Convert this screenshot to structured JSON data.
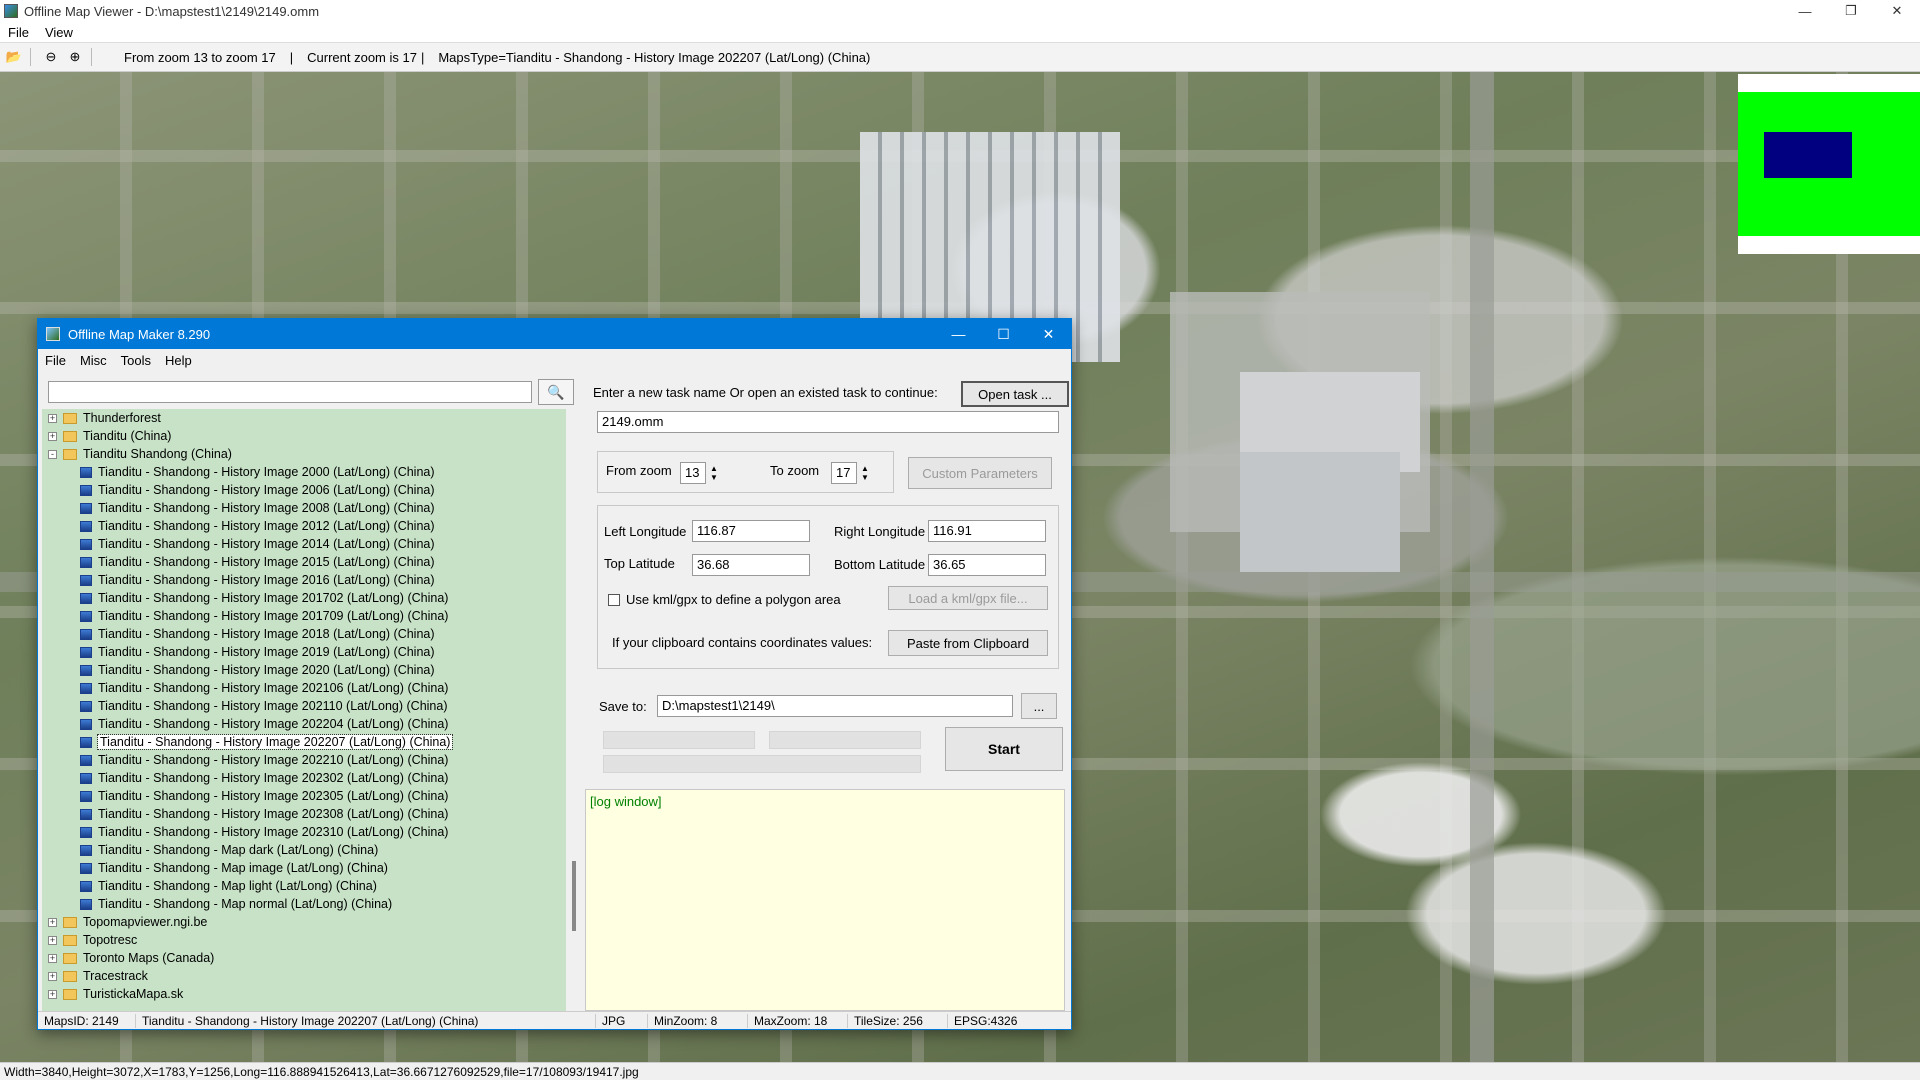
{
  "viewer": {
    "title": "Offline Map Viewer - D:\\mapstest1\\2149\\2149.omm",
    "menu": [
      "File",
      "View"
    ],
    "toolbar": {
      "zoom_range": "From zoom 13 to zoom 17",
      "current_zoom": "Current zoom is 17",
      "maps_type": "MapsType=Tianditu - Shandong - History Image 202207 (Lat/Long) (China)"
    },
    "status": "Width=3840,Height=3072,X=1783,Y=1256,Long=116.888941526413,Lat=36.6671276092529,file=17/108093/19417.jpg"
  },
  "maker": {
    "title": "Offline Map Maker 8.290",
    "menu": [
      "File",
      "Misc",
      "Tools",
      "Help"
    ],
    "search_value": "",
    "tree": [
      {
        "level": 0,
        "type": "folder",
        "expand": "+",
        "label": "Thunderforest"
      },
      {
        "level": 0,
        "type": "folder",
        "expand": "+",
        "label": "Tianditu (China)"
      },
      {
        "level": 0,
        "type": "folder",
        "expand": "-",
        "label": "Tianditu Shandong (China)"
      },
      {
        "level": 1,
        "type": "map",
        "label": "Tianditu - Shandong - History Image 2000 (Lat/Long) (China)"
      },
      {
        "level": 1,
        "type": "map",
        "label": "Tianditu - Shandong - History Image 2006 (Lat/Long) (China)"
      },
      {
        "level": 1,
        "type": "map",
        "label": "Tianditu - Shandong - History Image 2008 (Lat/Long) (China)"
      },
      {
        "level": 1,
        "type": "map",
        "label": "Tianditu - Shandong - History Image 2012 (Lat/Long) (China)"
      },
      {
        "level": 1,
        "type": "map",
        "label": "Tianditu - Shandong - History Image 2014 (Lat/Long) (China)"
      },
      {
        "level": 1,
        "type": "map",
        "label": "Tianditu - Shandong - History Image 2015 (Lat/Long) (China)"
      },
      {
        "level": 1,
        "type": "map",
        "label": "Tianditu - Shandong - History Image 2016 (Lat/Long) (China)"
      },
      {
        "level": 1,
        "type": "map",
        "label": "Tianditu - Shandong - History Image 201702 (Lat/Long) (China)"
      },
      {
        "level": 1,
        "type": "map",
        "label": "Tianditu - Shandong - History Image 201709 (Lat/Long) (China)"
      },
      {
        "level": 1,
        "type": "map",
        "label": "Tianditu - Shandong - History Image 2018 (Lat/Long) (China)"
      },
      {
        "level": 1,
        "type": "map",
        "label": "Tianditu - Shandong - History Image 2019 (Lat/Long) (China)"
      },
      {
        "level": 1,
        "type": "map",
        "label": "Tianditu - Shandong - History Image 2020 (Lat/Long) (China)"
      },
      {
        "level": 1,
        "type": "map",
        "label": "Tianditu - Shandong - History Image 202106 (Lat/Long) (China)"
      },
      {
        "level": 1,
        "type": "map",
        "label": "Tianditu - Shandong - History Image 202110 (Lat/Long) (China)"
      },
      {
        "level": 1,
        "type": "map",
        "label": "Tianditu - Shandong - History Image 202204 (Lat/Long) (China)"
      },
      {
        "level": 1,
        "type": "map",
        "label": "Tianditu - Shandong - History Image 202207 (Lat/Long) (China)",
        "selected": true
      },
      {
        "level": 1,
        "type": "map",
        "label": "Tianditu - Shandong - History Image 202210 (Lat/Long) (China)"
      },
      {
        "level": 1,
        "type": "map",
        "label": "Tianditu - Shandong - History Image 202302 (Lat/Long) (China)"
      },
      {
        "level": 1,
        "type": "map",
        "label": "Tianditu - Shandong - History Image 202305 (Lat/Long) (China)"
      },
      {
        "level": 1,
        "type": "map",
        "label": "Tianditu - Shandong - History Image 202308 (Lat/Long) (China)"
      },
      {
        "level": 1,
        "type": "map",
        "label": "Tianditu - Shandong - History Image 202310 (Lat/Long) (China)"
      },
      {
        "level": 1,
        "type": "map",
        "label": "Tianditu - Shandong - Map dark (Lat/Long) (China)"
      },
      {
        "level": 1,
        "type": "map",
        "label": "Tianditu - Shandong - Map image (Lat/Long) (China)"
      },
      {
        "level": 1,
        "type": "map",
        "label": "Tianditu - Shandong - Map light (Lat/Long) (China)"
      },
      {
        "level": 1,
        "type": "map",
        "label": "Tianditu - Shandong - Map normal (Lat/Long) (China)"
      },
      {
        "level": 0,
        "type": "folder",
        "expand": "+",
        "label": "Topomapviewer.ngi.be"
      },
      {
        "level": 0,
        "type": "folder",
        "expand": "+",
        "label": "Topotresc"
      },
      {
        "level": 0,
        "type": "folder",
        "expand": "+",
        "label": "Toronto Maps (Canada)"
      },
      {
        "level": 0,
        "type": "folder",
        "expand": "+",
        "label": "Tracestrack"
      },
      {
        "level": 0,
        "type": "folder",
        "expand": "+",
        "label": "TuristickaMapa.sk"
      }
    ],
    "task_prompt": "Enter a new task name Or open an existed task to continue:",
    "open_task_label": "Open task ...",
    "task_name": "2149.omm",
    "from_zoom_label": "From zoom",
    "from_zoom": "13",
    "to_zoom_label": "To zoom",
    "to_zoom": "17",
    "custom_params_label": "Custom Parameters",
    "left_lon_label": "Left Longitude",
    "left_lon": "116.87",
    "right_lon_label": "Right Longitude",
    "right_lon": "116.91",
    "top_lat_label": "Top Latitude",
    "top_lat": "36.68",
    "bottom_lat_label": "Bottom Latitude",
    "bottom_lat": "36.65",
    "kml_label": "Use kml/gpx to define a polygon area",
    "load_kml_label": "Load a kml/gpx file...",
    "clipboard_prompt": "If your clipboard contains coordinates values:",
    "paste_label": "Paste from Clipboard",
    "save_to_label": "Save to:",
    "save_to": "D:\\mapstest1\\2149\\",
    "browse_label": "...",
    "start_label": "Start",
    "log_text": "[log window]",
    "status": {
      "maps_id": "MapsID: 2149",
      "map_name": "Tianditu - Shandong - History Image 202207 (Lat/Long) (China)",
      "format": "JPG",
      "min_zoom": "MinZoom: 8",
      "max_zoom": "MaxZoom: 18",
      "tile_size": "TileSize: 256",
      "epsg": "EPSG:4326"
    }
  }
}
